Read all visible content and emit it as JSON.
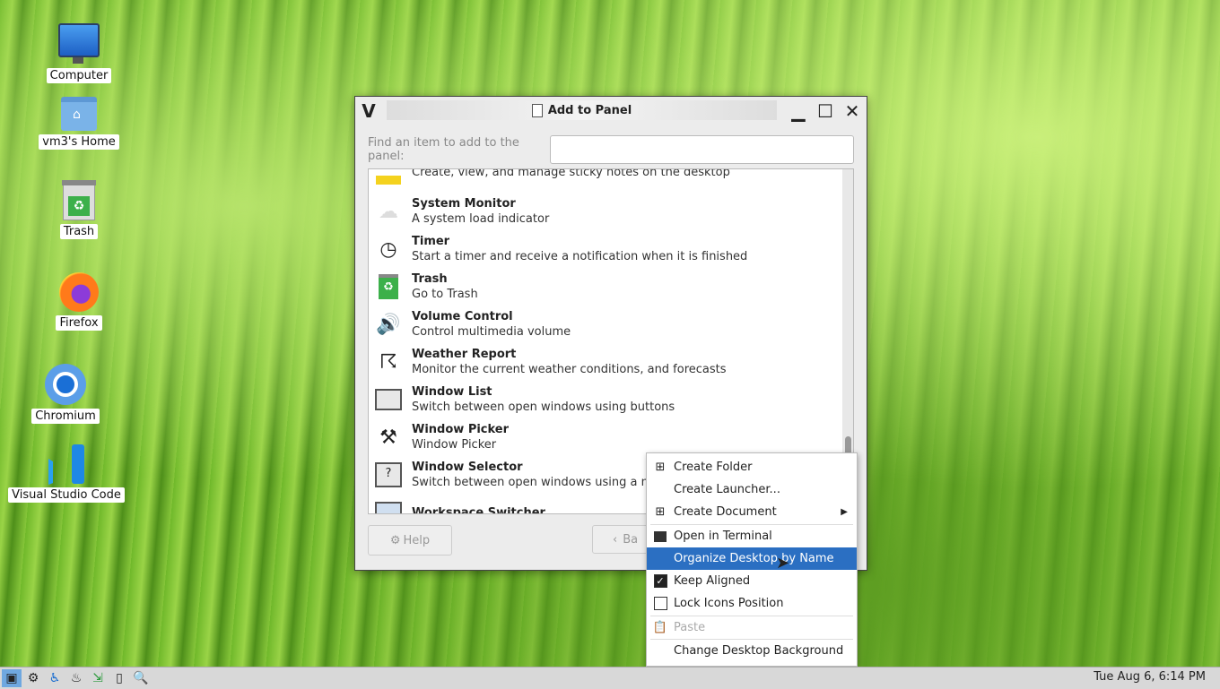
{
  "desktop": {
    "icons": [
      {
        "label": "Computer"
      },
      {
        "label": "vm3's Home"
      },
      {
        "label": "Trash"
      },
      {
        "label": "Firefox"
      },
      {
        "label": "Chromium"
      },
      {
        "label": "Visual Studio Code"
      }
    ]
  },
  "dialog": {
    "logo": "V",
    "title": "Add to Panel",
    "find_label": "Find an item to add to the panel:",
    "find_value": "",
    "items": [
      {
        "name": "",
        "desc": "Create, view, and manage sticky notes on the desktop",
        "icon": "sticky-notes-icon"
      },
      {
        "name": "System Monitor",
        "desc": "A system load indicator",
        "icon": "system-monitor-icon"
      },
      {
        "name": "Timer",
        "desc": "Start a timer and receive a notification when it is finished",
        "icon": "timer-icon"
      },
      {
        "name": "Trash",
        "desc": "Go to Trash",
        "icon": "trash-icon"
      },
      {
        "name": "Volume Control",
        "desc": "Control multimedia volume",
        "icon": "volume-icon"
      },
      {
        "name": "Weather Report",
        "desc": "Monitor the current weather conditions, and forecasts",
        "icon": "weather-icon"
      },
      {
        "name": "Window List",
        "desc": "Switch between open windows using buttons",
        "icon": "window-list-icon"
      },
      {
        "name": "Window Picker",
        "desc": "Window Picker",
        "icon": "window-picker-icon"
      },
      {
        "name": "Window Selector",
        "desc": "Switch between open windows using a menu",
        "icon": "window-selector-icon"
      },
      {
        "name": "Workspace Switcher",
        "desc": "",
        "icon": "workspace-switcher-icon"
      }
    ],
    "help_label": "Help",
    "back_label": "Ba"
  },
  "context_menu": {
    "items": [
      {
        "label": "Create Folder"
      },
      {
        "label": "Create Launcher..."
      },
      {
        "label": "Create Document"
      },
      {
        "label": "Open in Terminal"
      },
      {
        "label": "Organize Desktop by Name"
      },
      {
        "label": "Keep Aligned",
        "checked": true
      },
      {
        "label": "Lock Icons Position",
        "checked": false
      },
      {
        "label": "Paste"
      },
      {
        "label": "Change Desktop Background"
      }
    ]
  },
  "taskbar": {
    "clock": "Tue Aug  6,  6:14 PM"
  }
}
